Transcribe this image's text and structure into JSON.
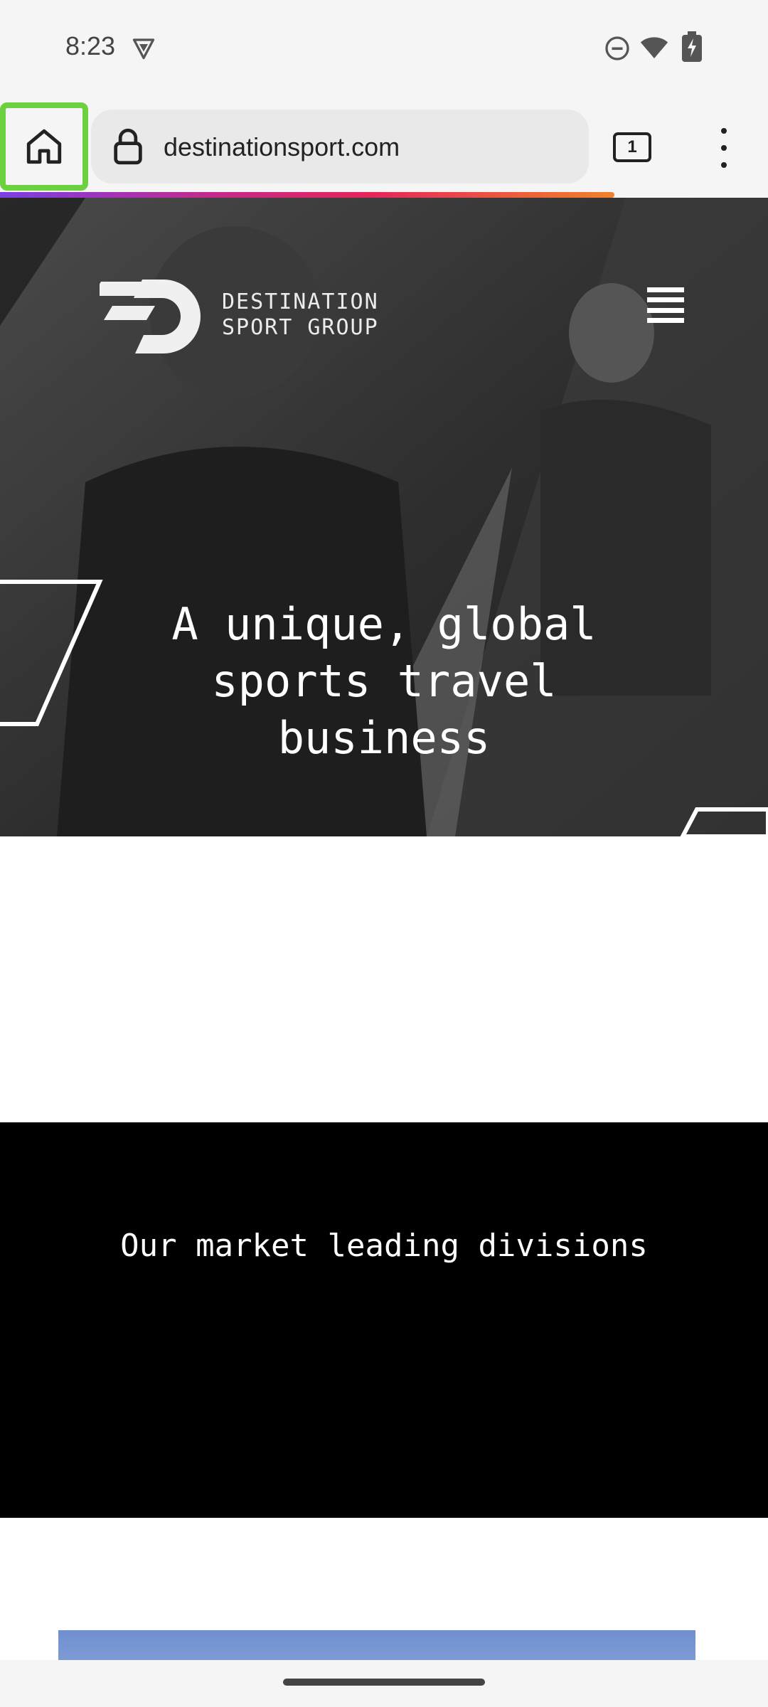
{
  "status_bar": {
    "time": "8:23",
    "icons": [
      "shield-vpn-icon",
      "do-not-disturb-icon",
      "wifi-icon",
      "battery-icon"
    ]
  },
  "browser": {
    "url": "destinationsport.com",
    "tab_count": "1",
    "icons": [
      "home-icon",
      "lock-icon",
      "tabs-icon",
      "more-menu-icon"
    ],
    "highlight_color": "#6bd13f"
  },
  "site": {
    "logo_line1": "DESTINATION",
    "logo_line2": "SPORT GROUP",
    "hero_line1": "A unique, global",
    "hero_line2": "sports travel",
    "hero_line3": "business",
    "divisions_title": "Our market leading divisions"
  }
}
